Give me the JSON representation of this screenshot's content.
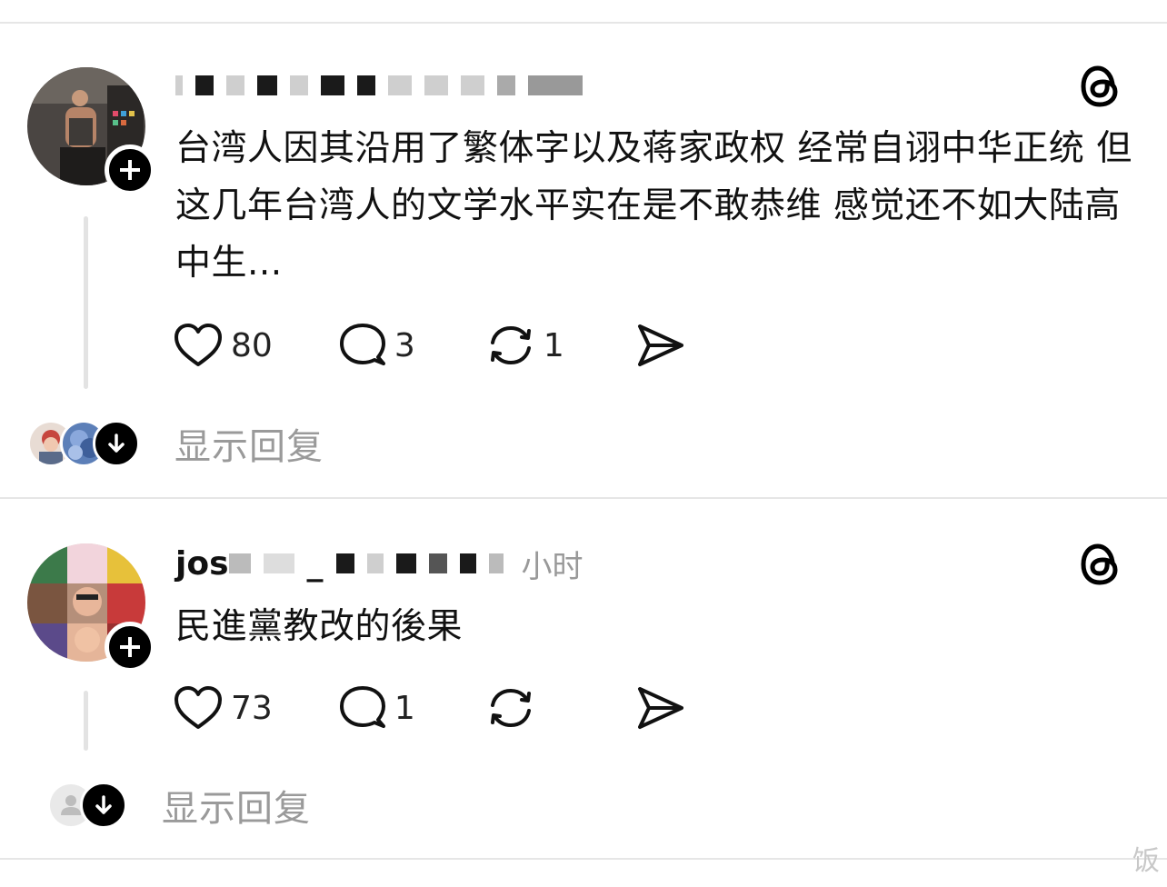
{
  "posts": [
    {
      "username_visible": "",
      "timestamp": "",
      "text": "台湾人因其沿用了繁体字以及蒋家政权 经常自诩中华正统 但这几年台湾人的文学水平实在是不敢恭维 感觉还不如大陆高中生...",
      "likes": "80",
      "comments": "3",
      "reposts": "1",
      "show_replies": "显示回复"
    },
    {
      "username_visible": "jos",
      "username_mid": "_",
      "timestamp": "小时",
      "text": "民進黨教改的後果",
      "likes": "73",
      "comments": "1",
      "reposts": "",
      "show_replies": "显示回复"
    }
  ],
  "watermark": "饭",
  "icons": {
    "like": "heart-icon",
    "comment": "comment-bubble-icon",
    "repost": "repost-icon",
    "share": "send-icon",
    "platform": "threads-logo-icon",
    "follow": "plus-icon",
    "expand": "arrow-down-icon"
  },
  "colors": {
    "background": "#ffffff",
    "text": "#111111",
    "muted": "#999999",
    "divider": "#e6e6e6",
    "badge": "#000000"
  }
}
